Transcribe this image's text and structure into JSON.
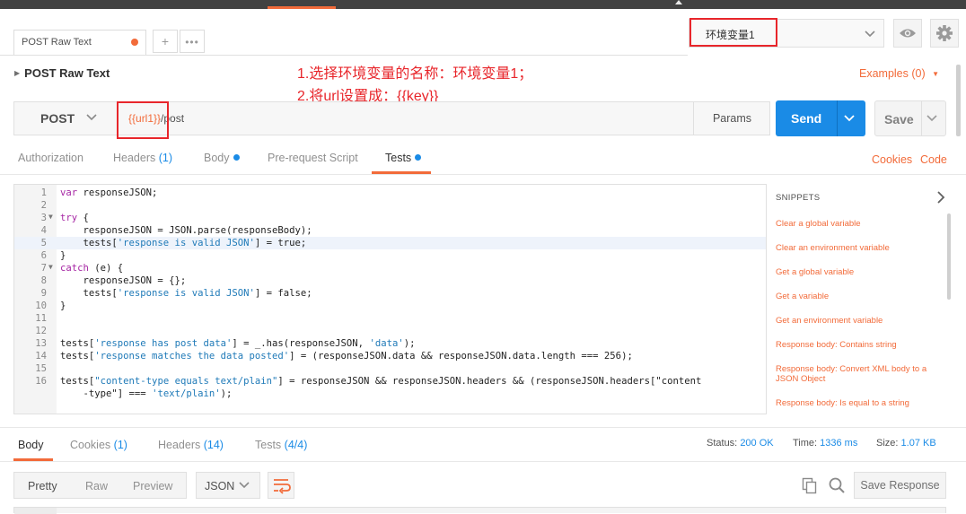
{
  "request_tab": {
    "title": "POST Raw Text"
  },
  "environment": {
    "selected": "环境变量1"
  },
  "breadcrumb": "POST Raw Text",
  "annotations": {
    "line1": "1.选择环境变量的名称：环境变量1；",
    "line2": "2.将url设置成：{{key}}"
  },
  "examples_label": "Examples (0)",
  "request": {
    "method": "POST",
    "url_variable": "{{url1}}",
    "url_path": "/post",
    "params_label": "Params",
    "send_label": "Send",
    "save_label": "Save"
  },
  "request_tabs": {
    "authorization": "Authorization",
    "headers": "Headers",
    "headers_count": "(1)",
    "body": "Body",
    "prerequest": "Pre-request Script",
    "tests": "Tests",
    "cookies": "Cookies",
    "code": "Code"
  },
  "code_lines": [
    {
      "n": "1",
      "code": "var responseJSON;"
    },
    {
      "n": "2",
      "code": ""
    },
    {
      "n": "3",
      "code": "try {",
      "fold": true
    },
    {
      "n": "4",
      "code": "    responseJSON = JSON.parse(responseBody);"
    },
    {
      "n": "5",
      "code": "    tests['response is valid JSON'] = true;",
      "highlight": true
    },
    {
      "n": "6",
      "code": "}"
    },
    {
      "n": "7",
      "code": "catch (e) {",
      "fold": true
    },
    {
      "n": "8",
      "code": "    responseJSON = {};"
    },
    {
      "n": "9",
      "code": "    tests['response is valid JSON'] = false;"
    },
    {
      "n": "10",
      "code": "}"
    },
    {
      "n": "11",
      "code": ""
    },
    {
      "n": "12",
      "code": ""
    },
    {
      "n": "13",
      "code": "tests['response has post data'] = _.has(responseJSON, 'data');"
    },
    {
      "n": "14",
      "code": "tests['response matches the data posted'] = (responseJSON.data && responseJSON.data.length === 256);"
    },
    {
      "n": "15",
      "code": ""
    },
    {
      "n": "16",
      "code": "tests[\"content-type equals text/plain\"] = responseJSON && responseJSON.headers && (responseJSON.headers[\"content"
    },
    {
      "n": "",
      "code": "    -type\"] === 'text/plain');"
    }
  ],
  "snippets": {
    "heading": "SNIPPETS",
    "items": [
      "Clear a global variable",
      "Clear an environment variable",
      "Get a global variable",
      "Get a variable",
      "Get an environment variable",
      "Response body: Contains string",
      "Response body: Convert XML body to a JSON Object",
      "Response body: Is equal to a string"
    ]
  },
  "response_tabs": {
    "body": "Body",
    "cookies": "Cookies",
    "cookies_count": "(1)",
    "headers": "Headers",
    "headers_count": "(14)",
    "tests": "Tests",
    "tests_count": "(4/4)"
  },
  "response_status": {
    "status_label": "Status:",
    "status_value": "200 OK",
    "time_label": "Time:",
    "time_value": "1336 ms",
    "size_label": "Size:",
    "size_value": "1.07 KB"
  },
  "response_toolbar": {
    "pretty": "Pretty",
    "raw": "Raw",
    "preview": "Preview",
    "format": "JSON",
    "save_response": "Save Response"
  },
  "colors": {
    "accent_orange": "#f26b3a",
    "send_blue": "#1a8be6",
    "annotation_red": "#e8262b"
  }
}
